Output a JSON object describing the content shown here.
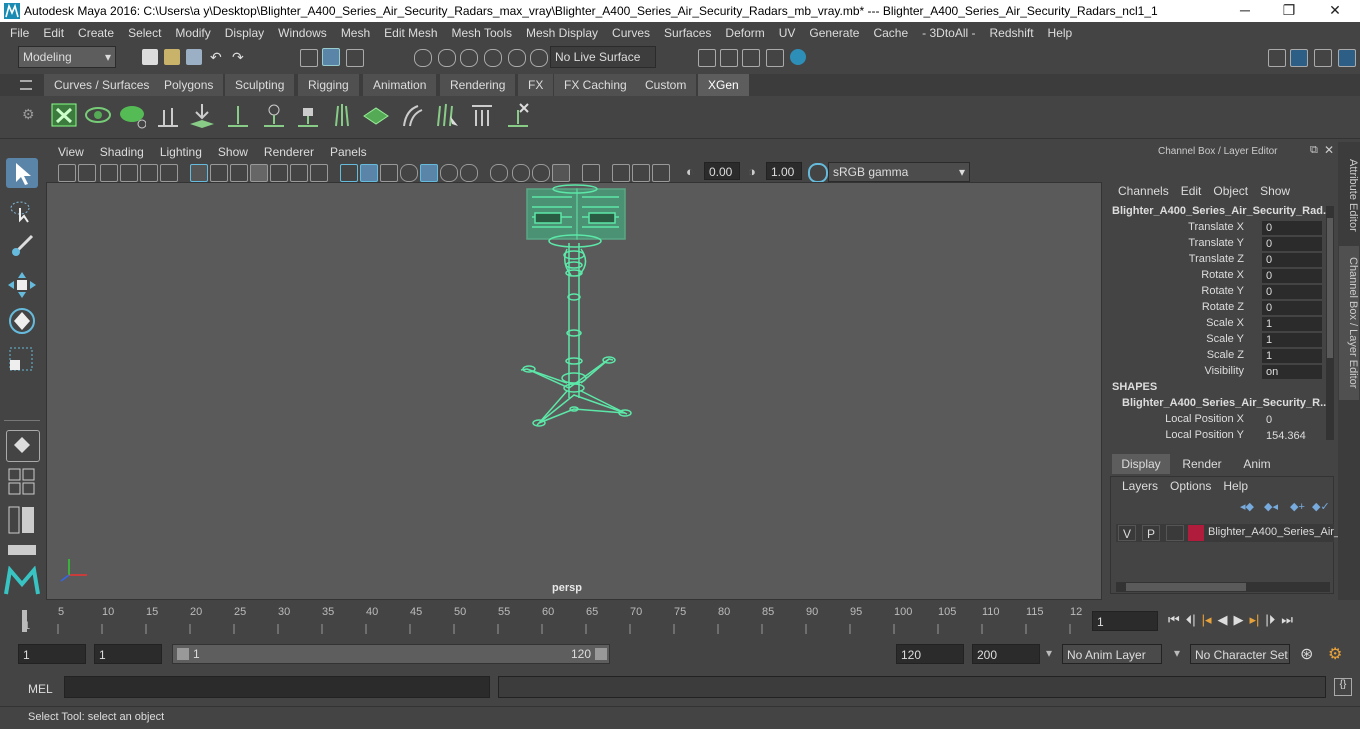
{
  "titlebar": {
    "title": "Autodesk Maya 2016: C:\\Users\\a y\\Desktop\\Blighter_A400_Series_Air_Security_Radars_max_vray\\Blighter_A400_Series_Air_Security_Radars_mb_vray.mb*   ---   Blighter_A400_Series_Air_Security_Radars_ncl1_1",
    "minimize": "─",
    "restore": "❐",
    "close": "✕"
  },
  "menubar": [
    "File",
    "Edit",
    "Create",
    "Select",
    "Modify",
    "Display",
    "Windows",
    "Mesh",
    "Edit Mesh",
    "Mesh Tools",
    "Mesh Display",
    "Curves",
    "Surfaces",
    "Deform",
    "UV",
    "Generate",
    "Cache",
    "- 3DtoAll -",
    "Redshift",
    "Help"
  ],
  "statusline": {
    "mode": "Modeling",
    "live_surface": "No Live Surface"
  },
  "shelf_tabs": [
    "Curves / Surfaces",
    "Polygons",
    "Sculpting",
    "Rigging",
    "Animation",
    "Rendering",
    "FX",
    "FX Caching",
    "Custom",
    "XGen"
  ],
  "shelf_active": "XGen",
  "viewport": {
    "menu": [
      "View",
      "Shading",
      "Lighting",
      "Show",
      "Renderer",
      "Panels"
    ],
    "exposure": "0.00",
    "gamma": "1.00",
    "color_space": "sRGB gamma",
    "camera_label": "persp"
  },
  "channel_box": {
    "header": "Channel Box / Layer Editor",
    "menu": [
      "Channels",
      "Edit",
      "Object",
      "Show"
    ],
    "object_name": "Blighter_A400_Series_Air_Security_Rad...",
    "channels": [
      {
        "label": "Translate X",
        "value": "0"
      },
      {
        "label": "Translate Y",
        "value": "0"
      },
      {
        "label": "Translate Z",
        "value": "0"
      },
      {
        "label": "Rotate X",
        "value": "0"
      },
      {
        "label": "Rotate Y",
        "value": "0"
      },
      {
        "label": "Rotate Z",
        "value": "0"
      },
      {
        "label": "Scale X",
        "value": "1"
      },
      {
        "label": "Scale Y",
        "value": "1"
      },
      {
        "label": "Scale Z",
        "value": "1"
      },
      {
        "label": "Visibility",
        "value": "on"
      }
    ],
    "shapes_header": "SHAPES",
    "shape_name": "Blighter_A400_Series_Air_Security_R...",
    "shape_channels": [
      {
        "label": "Local Position X",
        "value": "0"
      },
      {
        "label": "Local Position Y",
        "value": "154.364"
      }
    ]
  },
  "layer_editor": {
    "tabs": [
      "Display",
      "Render",
      "Anim"
    ],
    "active_tab": "Display",
    "menu": [
      "Layers",
      "Options",
      "Help"
    ],
    "layer": {
      "v": "V",
      "p": "P",
      "name": "Blighter_A400_Series_Air_",
      "color": "#b01c3c"
    }
  },
  "side_tabs": [
    "Attribute Editor",
    "Channel Box / Layer Editor"
  ],
  "timeline": {
    "ticks": [
      "5",
      "10",
      "15",
      "20",
      "25",
      "30",
      "35",
      "40",
      "45",
      "50",
      "55",
      "60",
      "65",
      "70",
      "75",
      "80",
      "85",
      "90",
      "95",
      "100",
      "105",
      "110",
      "115",
      "12"
    ],
    "start_marker": "1",
    "current_frame": "1"
  },
  "range": {
    "start": "1",
    "playback_start": "1",
    "slider_start": "1",
    "slider_end": "120",
    "playback_end": "120",
    "end": "200",
    "anim_layer": "No Anim Layer",
    "character_set": "No Character Set"
  },
  "cmdline": {
    "label": "MEL"
  },
  "helpline": {
    "text": "Select Tool: select an object"
  },
  "colors": {
    "accent": "#5dc6a0",
    "wire": "#5ce8a8"
  }
}
